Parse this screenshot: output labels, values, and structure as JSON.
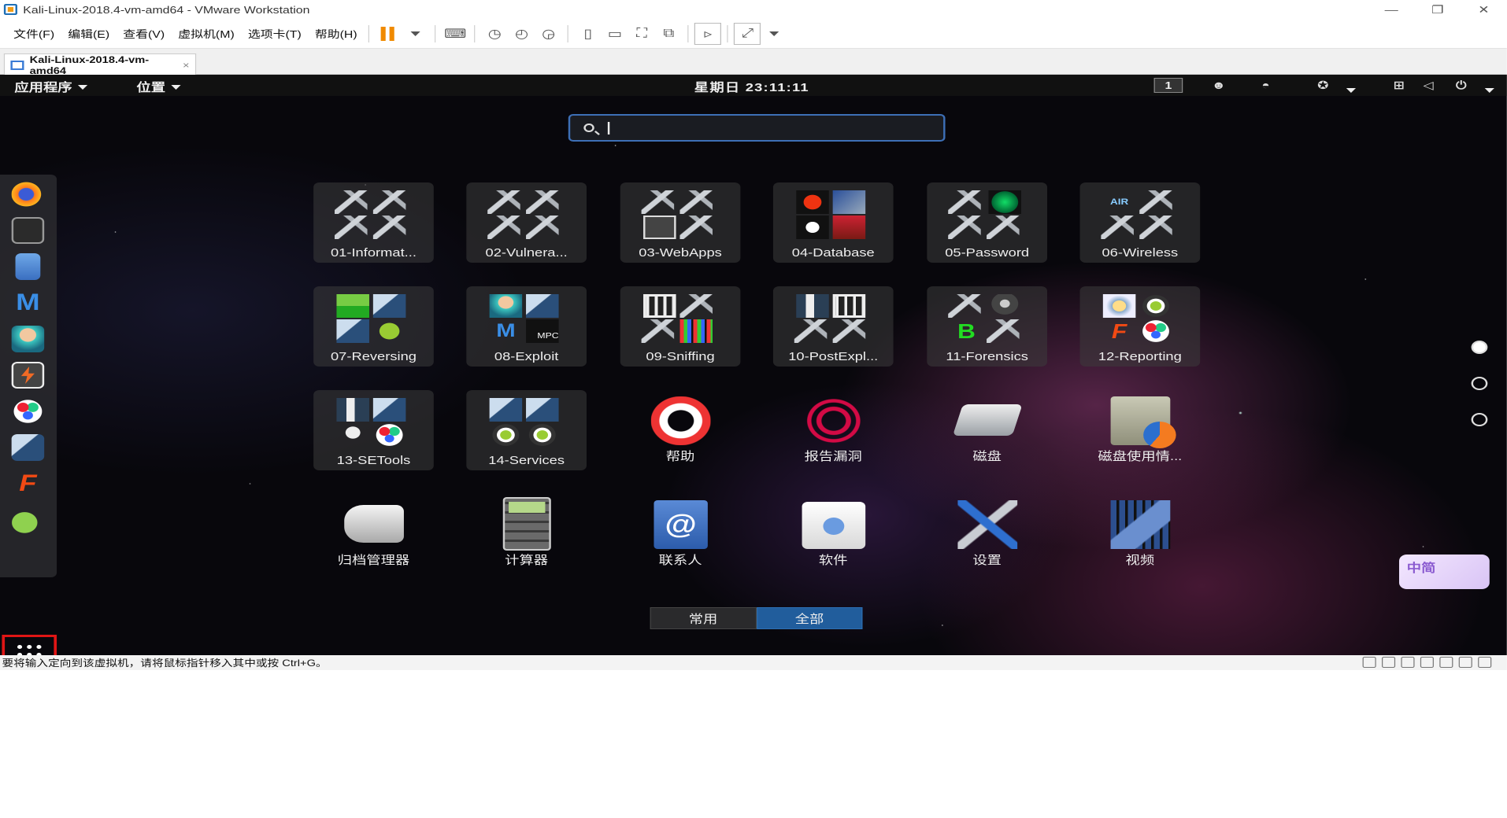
{
  "window": {
    "title": "Kali-Linux-2018.4-vm-amd64 - VMware Workstation",
    "minimize": "—",
    "maximize": "❐",
    "close": "✕"
  },
  "menu": [
    "文件(F)",
    "编辑(E)",
    "查看(V)",
    "虚拟机(M)",
    "选项卡(T)",
    "帮助(H)"
  ],
  "tab": {
    "label": "Kali-Linux-2018.4-vm-amd64",
    "close": "×"
  },
  "guest": {
    "topbar": {
      "apps_menu": "应用程序",
      "places_menu": "位置",
      "clock": "星期日 23:11:11",
      "workspace": "1"
    },
    "search": {
      "value": ""
    },
    "dash_items": [
      "firefox-icon",
      "terminal-icon",
      "files-icon",
      "metasploit-icon",
      "armitage-icon",
      "burpsuite-icon",
      "maltego-icon",
      "beef-icon",
      "faraday-icon",
      "leafpad-icon"
    ],
    "folders": [
      {
        "label": "01-Informat..."
      },
      {
        "label": "02-Vulnera..."
      },
      {
        "label": "03-WebApps"
      },
      {
        "label": "04-Database"
      },
      {
        "label": "05-Password"
      },
      {
        "label": "06-Wireless"
      },
      {
        "label": "07-Reversing"
      },
      {
        "label": "08-Exploit"
      },
      {
        "label": "09-Sniffing"
      },
      {
        "label": "10-PostExpl..."
      },
      {
        "label": "11-Forensics"
      },
      {
        "label": "12-Reporting"
      },
      {
        "label": "13-SETools"
      },
      {
        "label": "14-Services"
      }
    ],
    "apps": [
      {
        "label": "帮助",
        "icon": "help-lifebuoy-icon"
      },
      {
        "label": "报告漏洞",
        "icon": "debian-swirl-icon"
      },
      {
        "label": "磁盘",
        "icon": "disk-icon"
      },
      {
        "label": "磁盘使用情...",
        "icon": "disk-usage-icon"
      },
      {
        "label": "归档管理器",
        "icon": "archive-manager-icon"
      },
      {
        "label": "计算器",
        "icon": "calculator-icon"
      },
      {
        "label": "联系人",
        "icon": "contacts-icon"
      },
      {
        "label": "软件",
        "icon": "software-bag-icon"
      },
      {
        "label": "设置",
        "icon": "settings-tools-icon"
      },
      {
        "label": "视频",
        "icon": "videos-icon"
      }
    ],
    "switch": {
      "frequent": "常用",
      "all": "全部"
    },
    "ime": "中简"
  },
  "status": {
    "text": "要将输入定向到该虚拟机，请将鼠标指针移入其中或按 Ctrl+G。"
  },
  "colors": {
    "accent": "#215d9c",
    "highlight": "#e01515",
    "pause": "#f08a00"
  }
}
